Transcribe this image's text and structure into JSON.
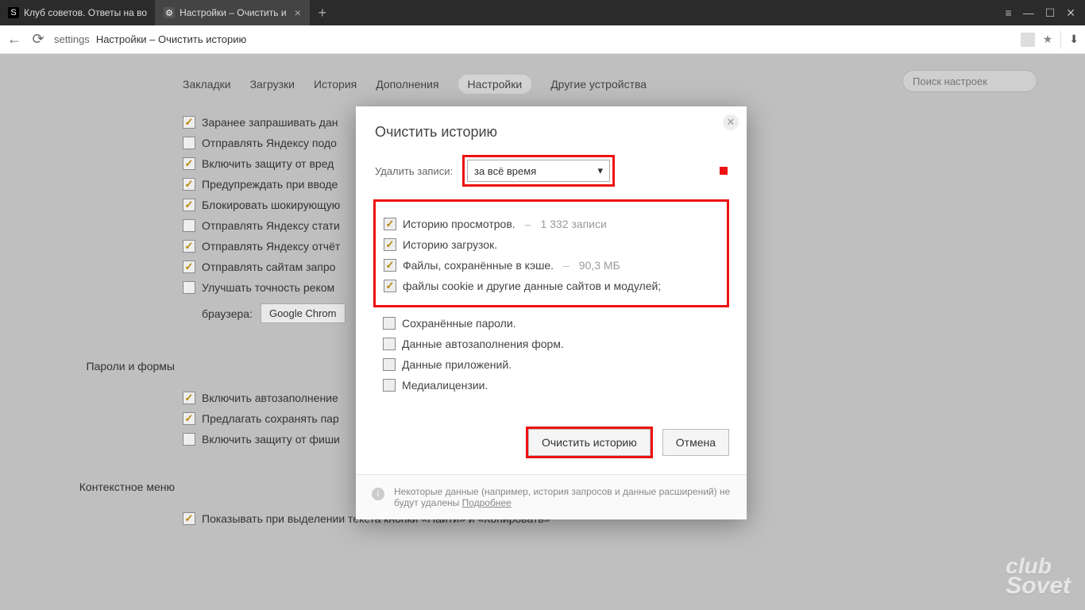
{
  "titlebar": {
    "tabs": [
      {
        "title": "Клуб советов. Ответы на во",
        "fav": "S"
      },
      {
        "title": "Настройки – Очистить и",
        "fav": "⚙"
      }
    ],
    "newtab": "+",
    "ctl": {
      "menu": "≡",
      "min": "—",
      "max": "☐",
      "close": "✕"
    }
  },
  "address": {
    "back": "←",
    "reload": "⟳",
    "scheme": "settings",
    "title": "Настройки – Очистить историю",
    "star": "★",
    "dl": "⬇"
  },
  "nav": {
    "items": [
      "Закладки",
      "Загрузки",
      "История",
      "Дополнения",
      "Настройки",
      "Другие устройства"
    ],
    "active_index": 4
  },
  "search": {
    "placeholder": "Поиск настроек"
  },
  "settings": {
    "opts": [
      {
        "on": true,
        "label": "Заранее запрашивать дан"
      },
      {
        "on": false,
        "label": "Отправлять Яндексу подо"
      },
      {
        "on": true,
        "label": "Включить защиту от вред"
      },
      {
        "on": true,
        "label": "Предупреждать при вводе"
      },
      {
        "on": true,
        "label": "Блокировать шокирующую"
      },
      {
        "on": false,
        "label": "Отправлять Яндексу стати"
      },
      {
        "on": true,
        "label": "Отправлять Яндексу отчёт"
      },
      {
        "on": true,
        "label": "Отправлять сайтам запро"
      },
      {
        "on": false,
        "label": "Улучшать точность реком"
      }
    ],
    "browser_label": "браузера:",
    "browser_value": "Google Chrom",
    "section_forms": "Пароли и формы",
    "forms": [
      {
        "on": true,
        "label": "Включить автозаполнение"
      },
      {
        "on": true,
        "label": "Предлагать сохранять пар"
      },
      {
        "on": false,
        "label": "Включить защиту от фиши"
      }
    ],
    "section_ctx": "Контекстное меню",
    "ctx": [
      {
        "on": true,
        "label": "Показывать при выделении текста кнопки «Найти» и «Копировать»"
      }
    ]
  },
  "modal": {
    "title": "Очистить историю",
    "range_label": "Удалить записи:",
    "range_value": "за всё время",
    "chev": "▾",
    "checks_hl": [
      {
        "on": true,
        "label": "Историю просмотров.",
        "extra": "1 332 записи"
      },
      {
        "on": true,
        "label": "Историю загрузок."
      },
      {
        "on": true,
        "label": "Файлы, сохранённые в кэше.",
        "extra": "90,3 МБ"
      },
      {
        "on": true,
        "label": "файлы cookie и другие данные сайтов и модулей;"
      }
    ],
    "checks_plain": [
      {
        "on": false,
        "label": "Сохранённые пароли."
      },
      {
        "on": false,
        "label": "Данные автозаполнения форм."
      },
      {
        "on": false,
        "label": "Данные приложений."
      },
      {
        "on": false,
        "label": "Медиалицензии."
      }
    ],
    "btn_clear": "Очистить историю",
    "btn_cancel": "Отмена",
    "footer": "Некоторые данные (например, история запросов и данные расширений) не будут удалены",
    "footer_link": "Подробнее"
  },
  "watermark": {
    "l1": "club",
    "l2": "Sovet"
  }
}
